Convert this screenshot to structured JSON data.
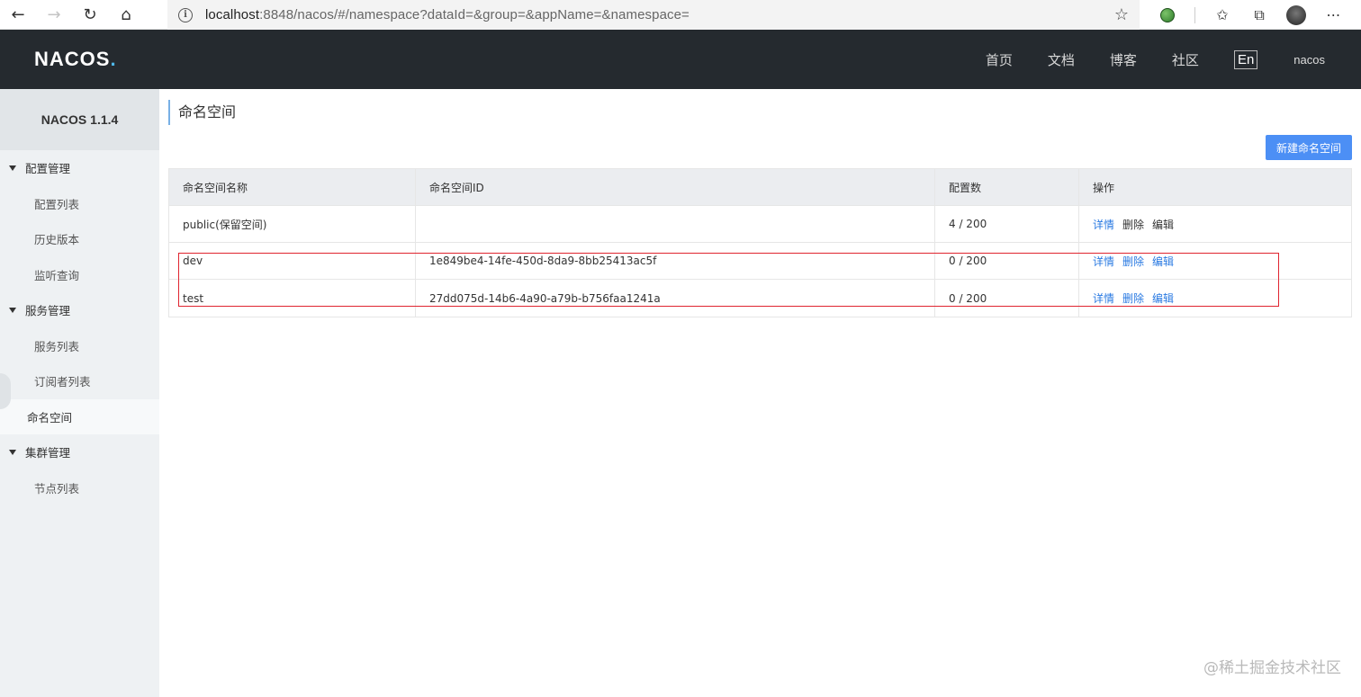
{
  "browser": {
    "url_host": "localhost",
    "url_rest": ":8848/nacos/#/namespace?dataId=&group=&appName=&namespace="
  },
  "header": {
    "logo": "NACOS",
    "logo_dot": ".",
    "nav": [
      "首页",
      "文档",
      "博客",
      "社区"
    ],
    "lang": "En",
    "user": "nacos"
  },
  "sidebar": {
    "title": "NACOS 1.1.4",
    "groups": [
      {
        "label": "配置管理",
        "items": [
          "配置列表",
          "历史版本",
          "监听查询"
        ]
      },
      {
        "label": "服务管理",
        "items": [
          "服务列表",
          "订阅者列表"
        ]
      },
      {
        "label": "命名空间"
      },
      {
        "label": "集群管理",
        "items": [
          "节点列表"
        ]
      }
    ]
  },
  "main": {
    "title": "命名空间",
    "create_button": "新建命名空间",
    "columns": [
      "命名空间名称",
      "命名空间ID",
      "配置数",
      "操作"
    ],
    "rows": [
      {
        "name": "public(保留空间)",
        "id": "",
        "count": "4 / 200",
        "actions": [
          "详情",
          "删除",
          "编辑"
        ]
      },
      {
        "name": "dev",
        "id": "1e849be4-14fe-450d-8da9-8bb25413ac5f",
        "count": "0 / 200",
        "actions": [
          "详情",
          "删除",
          "编辑"
        ]
      },
      {
        "name": "test",
        "id": "27dd075d-14b6-4a90-a79b-b756faa1241a",
        "count": "0 / 200",
        "actions": [
          "详情",
          "删除",
          "编辑"
        ]
      }
    ]
  },
  "watermark": "@稀土掘金技术社区",
  "colors": {
    "header_bg": "#252a2f",
    "accent": "#4c8ff5",
    "link": "#2a7ae2",
    "highlight": "#e0242f"
  }
}
